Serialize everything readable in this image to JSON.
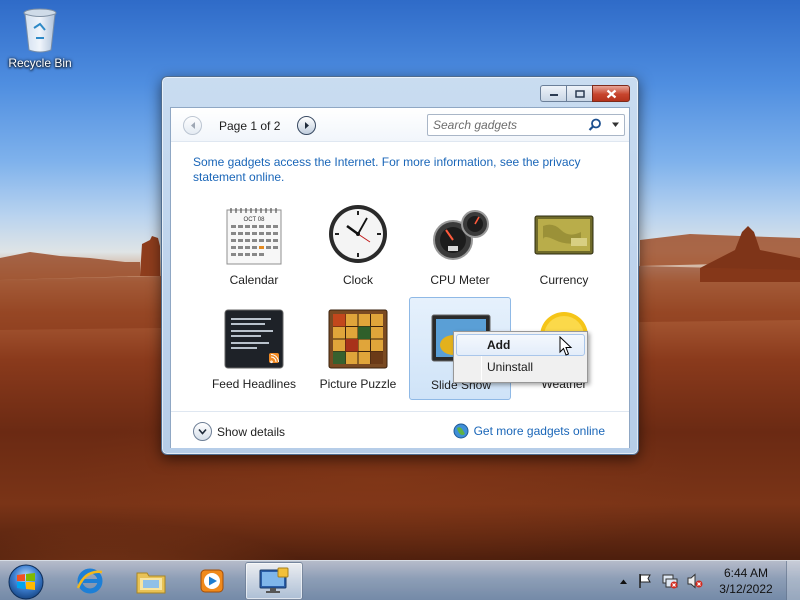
{
  "desktop": {
    "icons": [
      {
        "label": "Recycle Bin",
        "icon": "recycle-bin-icon"
      }
    ]
  },
  "window": {
    "title": "",
    "caption_buttons": [
      "minimize",
      "maximize",
      "close"
    ],
    "pager": {
      "label": "Page 1 of 2"
    },
    "search": {
      "placeholder": "Search gadgets",
      "value": ""
    },
    "info_text": "Some gadgets access the Internet.  For more information, see the privacy statement online.",
    "gadgets": [
      {
        "name": "Calendar",
        "icon": "calendar-icon",
        "calendar_month": "OCT 08",
        "selected": false
      },
      {
        "name": "Clock",
        "icon": "clock-icon",
        "selected": false
      },
      {
        "name": "CPU Meter",
        "icon": "cpu-meter-icon",
        "selected": false
      },
      {
        "name": "Currency",
        "icon": "currency-icon",
        "selected": false
      },
      {
        "name": "Feed Headlines",
        "icon": "feed-headlines-icon",
        "selected": false
      },
      {
        "name": "Picture Puzzle",
        "icon": "picture-puzzle-icon",
        "selected": false
      },
      {
        "name": "Slide Show",
        "icon": "slide-show-icon",
        "selected": true
      },
      {
        "name": "Weather",
        "icon": "weather-icon",
        "selected": false
      }
    ],
    "show_details_label": "Show details",
    "get_more_label": "Get more gadgets online"
  },
  "context_menu": {
    "items": [
      {
        "label": "Add",
        "bold": true,
        "hovered": true
      },
      {
        "label": "Uninstall",
        "bold": false,
        "hovered": false
      }
    ]
  },
  "taskbar": {
    "pinned": [
      "start-orb-icon",
      "internet-explorer-icon",
      "windows-explorer-icon",
      "media-player-icon",
      "gadgets-icon"
    ],
    "active": "gadgets-icon",
    "tray_icons": [
      "show-hidden-icons-icon",
      "action-center-flag-icon",
      "network-icon",
      "volume-muted-icon"
    ],
    "clock": {
      "time": "6:44 AM",
      "date": "3/12/2022"
    }
  },
  "colors": {
    "link": "#1a66b8",
    "selection": "#cfe3f8",
    "close_button": "#c7452d"
  }
}
